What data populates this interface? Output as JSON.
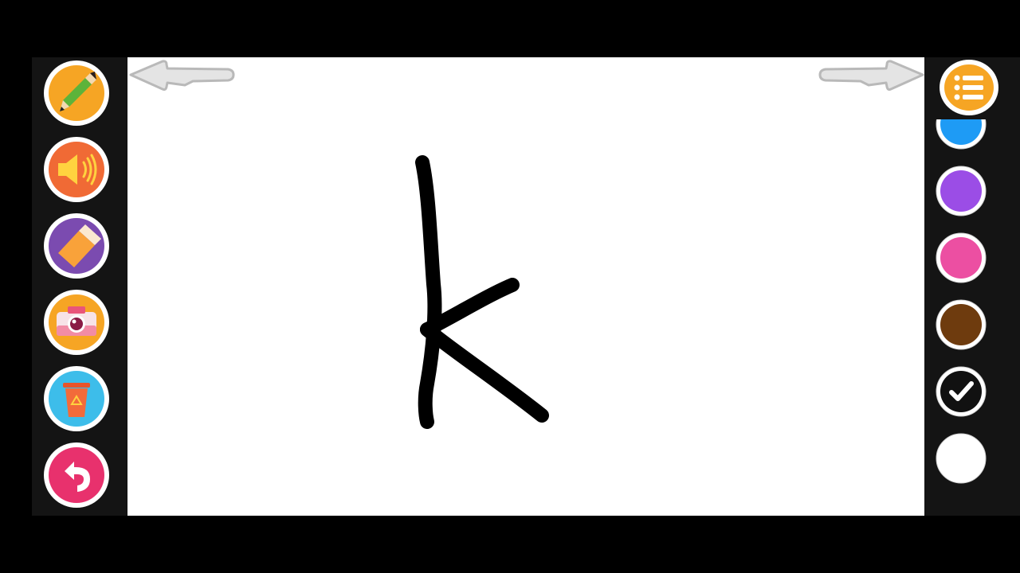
{
  "toolbar_left": {
    "tools": [
      {
        "name": "pencil-tool",
        "icon": "pencil-icon",
        "color": "#F6A524"
      },
      {
        "name": "sound-tool",
        "icon": "speaker-icon",
        "color": "#F06A35"
      },
      {
        "name": "eraser-tool",
        "icon": "eraser-icon",
        "color": "#7B4BB0"
      },
      {
        "name": "camera-tool",
        "icon": "camera-icon",
        "color": "#F6A524"
      },
      {
        "name": "trash-tool",
        "icon": "trash-icon",
        "color": "#3DBDEA"
      },
      {
        "name": "undo-tool",
        "icon": "undo-icon",
        "color": "#E8316D"
      }
    ]
  },
  "toolbar_right": {
    "menu": {
      "icon": "list-menu-icon",
      "color": "#F6A524"
    },
    "palette": [
      {
        "color": "#1E9BF5",
        "selected": false
      },
      {
        "color": "#9B4DE6",
        "selected": false
      },
      {
        "color": "#EC4FA2",
        "selected": false
      },
      {
        "color": "#6E3B0E",
        "selected": false
      },
      {
        "color": "#111111",
        "selected": true
      },
      {
        "color": "#FFFFFF",
        "selected": false
      }
    ]
  },
  "navigation": {
    "previous_icon": "arrow-left-icon",
    "next_icon": "arrow-right-icon"
  },
  "drawing": {
    "stroke_color": "#000000"
  }
}
